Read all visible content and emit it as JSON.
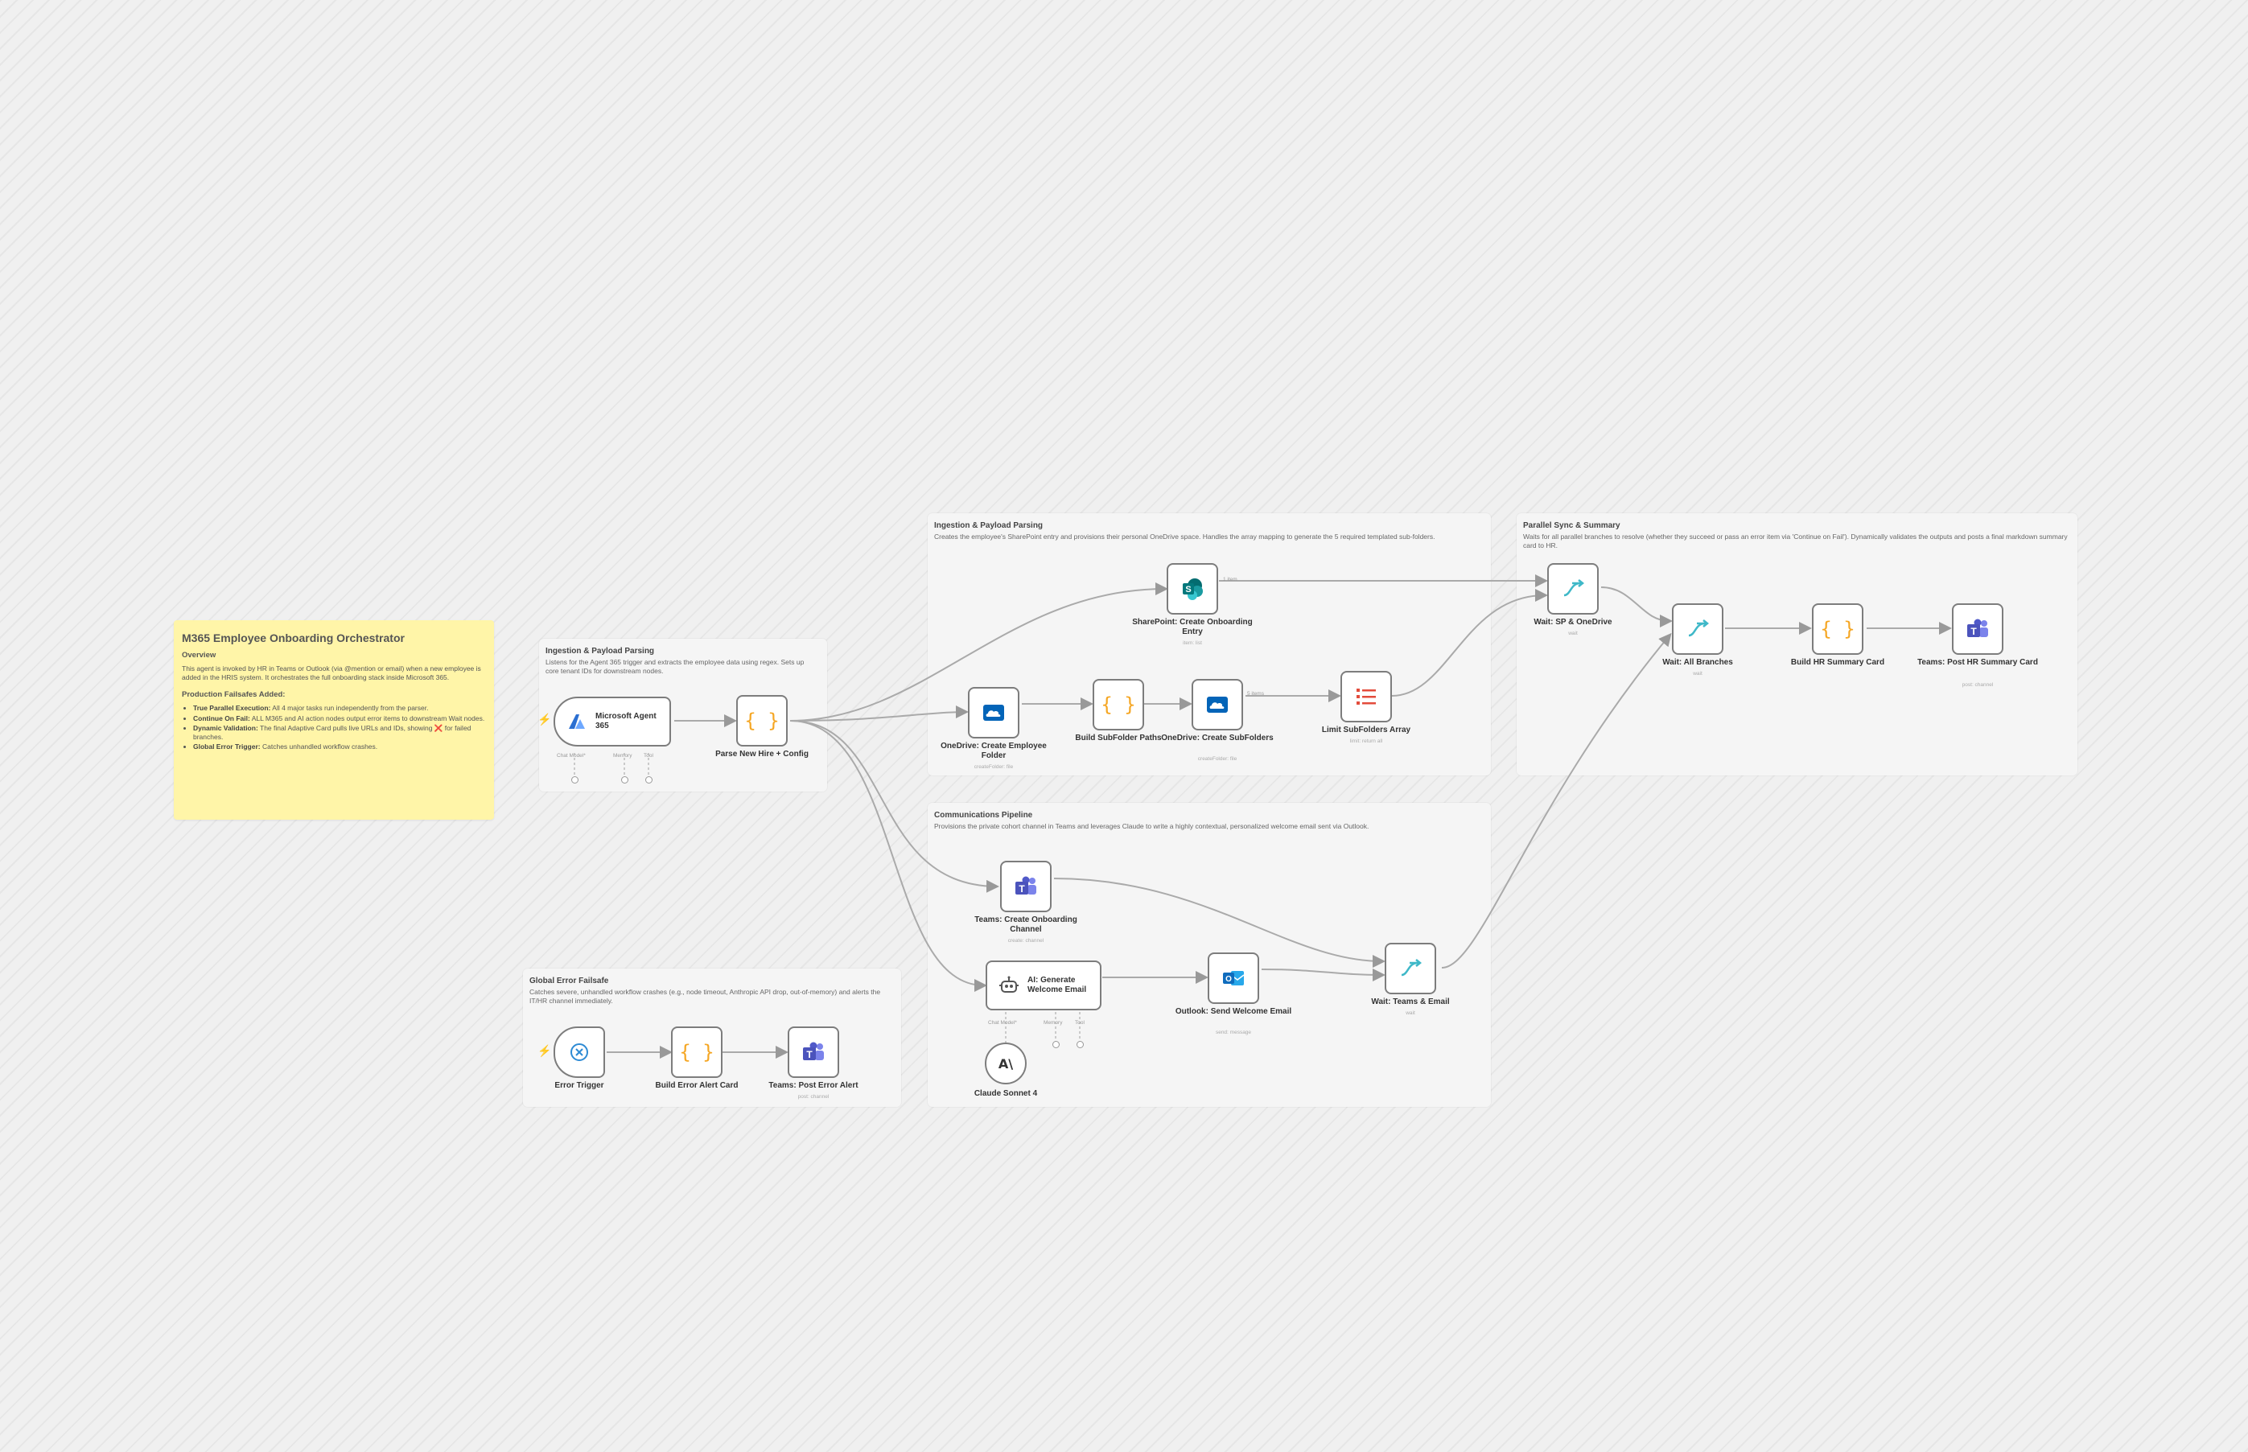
{
  "sticky": {
    "title": "M365 Employee Onboarding Orchestrator",
    "overview_heading": "Overview",
    "overview_text": "This agent is invoked by HR in Teams or Outlook (via @mention or email) when a new employee is added in the HRIS system. It orchestrates the full onboarding stack inside Microsoft 365.",
    "failsafes_heading": "Production Failsafes Added:",
    "failsafes": [
      {
        "label": "True Parallel Execution:",
        "text": "All 4 major tasks run independently from the parser."
      },
      {
        "label": "Continue On Fail:",
        "text": "ALL M365 and AI action nodes output error items to downstream Wait nodes."
      },
      {
        "label": "Dynamic Validation:",
        "text": "The final Adaptive Card pulls live URLs and IDs, showing ❌ for failed branches."
      },
      {
        "label": "Global Error Trigger:",
        "text": "Catches unhandled workflow crashes."
      }
    ]
  },
  "groups": {
    "ingestion": {
      "title": "Ingestion & Payload Parsing",
      "desc": "Listens for the Agent 365 trigger and extracts the employee data using regex. Sets up core tenant IDs for downstream nodes."
    },
    "provisioning": {
      "title": "Ingestion & Payload Parsing",
      "desc": "Creates the employee's SharePoint entry and provisions their personal OneDrive space. Handles the array mapping to generate the 5 required templated sub-folders."
    },
    "sync": {
      "title": "Parallel Sync & Summary",
      "desc": "Waits for all parallel branches to resolve (whether they succeed or pass an error item via 'Continue on Fail'). Dynamically validates the outputs and posts a final markdown summary card to HR."
    },
    "comms": {
      "title": "Communications Pipeline",
      "desc": "Provisions the private cohort channel in Teams and leverages Claude to write a highly contextual, personalized welcome email sent via Outlook."
    },
    "error": {
      "title": "Global Error Failsafe",
      "desc": "Catches severe, unhandled workflow crashes (e.g., node timeout, Anthropic API drop, out-of-memory) and alerts the IT/HR channel immediately."
    }
  },
  "nodes": {
    "agent": {
      "label": "Microsoft Agent 365",
      "ports": [
        "Chat Model*",
        "Memory",
        "Tool"
      ]
    },
    "parse": {
      "label": "Parse New Hire + Config"
    },
    "sharepoint": {
      "label": "SharePoint: Create Onboarding Entry",
      "sub": "item: list"
    },
    "onedrive_folder": {
      "label": "OneDrive: Create Employee Folder",
      "sub": "createFolder: file"
    },
    "build_paths": {
      "label": "Build SubFolder Paths"
    },
    "onedrive_sub": {
      "label": "OneDrive: Create SubFolders",
      "sub": "createFolder: file"
    },
    "limit": {
      "label": "Limit SubFolders Array",
      "sub": "limit: return all"
    },
    "wait_sp": {
      "label": "Wait: SP & OneDrive",
      "sub": "wait"
    },
    "wait_all": {
      "label": "Wait: All Branches",
      "sub": "wait"
    },
    "build_summary": {
      "label": "Build HR Summary Card"
    },
    "teams_summary": {
      "label": "Teams: Post HR Summary Card",
      "sub": "post: channel"
    },
    "teams_channel": {
      "label": "Teams: Create Onboarding Channel",
      "sub": "create: channel"
    },
    "ai_email": {
      "label": "AI: Generate Welcome Email",
      "ports": [
        "Chat Model*",
        "Memory",
        "Tool"
      ]
    },
    "claude": {
      "label": "Claude Sonnet 4"
    },
    "outlook": {
      "label": "Outlook: Send Welcome Email",
      "sub": "send: message"
    },
    "wait_teams": {
      "label": "Wait: Teams & Email",
      "sub": "wait"
    },
    "error_trigger": {
      "label": "Error Trigger"
    },
    "build_error": {
      "label": "Build Error Alert Card"
    },
    "teams_error": {
      "label": "Teams: Post Error Alert",
      "sub": "post: channel"
    }
  },
  "edge_labels": {
    "item": "1 item",
    "items": "5 items"
  },
  "colors": {
    "canvas": "#efefef",
    "sticky": "#fff5a8",
    "group": "#f5f5f5",
    "node_border": "#7d7d7d",
    "edge": "#aaaaaa",
    "trigger_bolt": "#ff6d2d",
    "code_brace": "#f5a623",
    "teams": "#5b5fc7",
    "sharepoint": "#038387",
    "onedrive": "#0364b8",
    "outlook": "#0f6cbd",
    "wait": "#3fb8c8",
    "limit": "#e34c3c",
    "error": "#2e8bd4"
  }
}
